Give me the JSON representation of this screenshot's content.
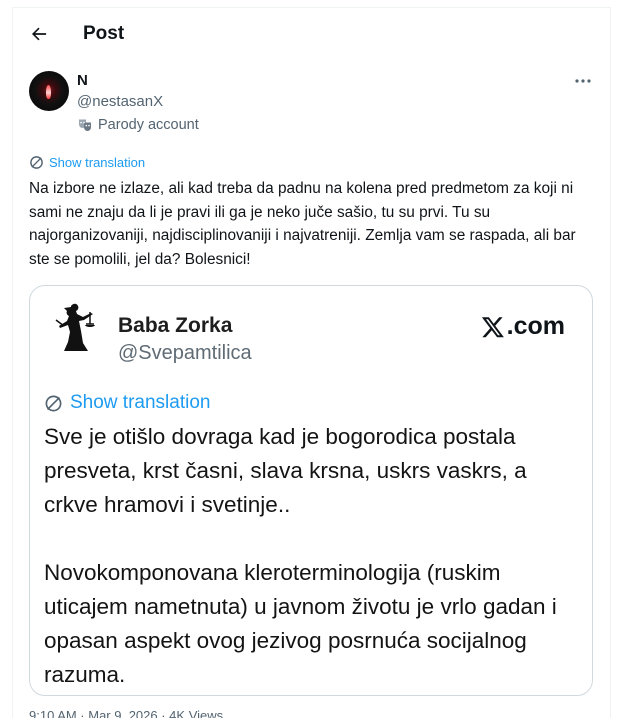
{
  "header": {
    "title": "Post"
  },
  "author": {
    "name": "N",
    "handle": "@nestasanX",
    "badge": "Parody account"
  },
  "post": {
    "show_translation": "Show translation",
    "text": "Na izbore ne izlaze, ali kad treba da padnu na kolena pred predmetom za koji ni sami ne znaju da li je pravi ili ga je neko juče sašio, tu su prvi. Tu su najorganizovaniji, najdisciplinovaniji i najvatreniji. Zemlja vam se raspada, ali bar ste se pomolili, jel da? Bolesnici!",
    "timestamp": "9:10 AM · Mar 9, 2026 · 4K Views"
  },
  "embedded": {
    "name": "Baba Zorka",
    "handle": "@Svepamtilica",
    "site": ".com",
    "show_translation": "Show translation",
    "paragraph1": "Sve je otišlo dovraga kad je bogorodica postala presveta, krst časni, slava krsna, uskrs vaskrs, a crkve hramovi i svetinje..",
    "paragraph2": "Novokomponovana kleroterminologija (ruskim uticajem nametnuta) u javnom životu je vrlo gadan i opasan aspekt ovog jezivog posrnuća socijalnog razuma."
  },
  "colors": {
    "link": "#1d9bf0",
    "secondary_text": "#536471",
    "border": "#cfd9de"
  }
}
